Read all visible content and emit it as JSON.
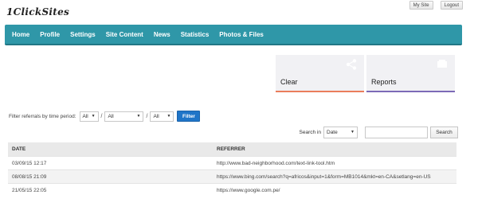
{
  "app": {
    "logo": "1ClickSites"
  },
  "top_links": {
    "my_site": "My Site",
    "logout": "Logout"
  },
  "nav": {
    "items": [
      {
        "label": "Home"
      },
      {
        "label": "Profile"
      },
      {
        "label": "Settings"
      },
      {
        "label": "Site Content"
      },
      {
        "label": "News"
      },
      {
        "label": "Statistics"
      },
      {
        "label": "Photos & Files"
      }
    ]
  },
  "tiles": {
    "clear": {
      "label": "Clear",
      "icon": "share-icon",
      "accent": "#ea7d5c"
    },
    "reports": {
      "label": "Reports",
      "icon": "report-icon",
      "accent": "#7c6ab7"
    }
  },
  "filter": {
    "label": "Filter referrals by time period:",
    "period1": "All",
    "period2": "All",
    "period3": "All",
    "button": "Filter"
  },
  "search": {
    "label": "Search in",
    "field": "Date",
    "value": "",
    "button": "Search"
  },
  "table": {
    "headers": {
      "date": "DATE",
      "referrer": "REFERRER"
    },
    "rows": [
      {
        "date": "03/09/15 12:17",
        "referrer": "http://www.bad-neighborhood.com/text-link-tool.htm"
      },
      {
        "date": "08/08/15 21:09",
        "referrer": "https://www.bing.com/search?q=africos&input=1&form=MB1014&mkt=en-CA&setlang=en-US"
      },
      {
        "date": "21/05/15 22:05",
        "referrer": "https://www.google.com.pe/"
      }
    ]
  },
  "colors": {
    "nav_bg": "#2f97a8",
    "filter_button": "#1f75c8"
  }
}
